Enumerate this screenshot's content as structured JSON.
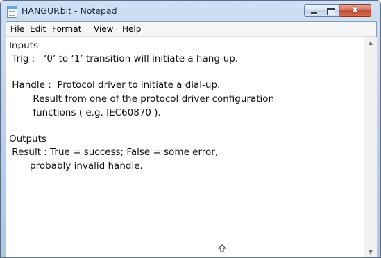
{
  "window": {
    "title": "HANGUP.blt - Notepad",
    "close_glyph": "x"
  },
  "menu": {
    "items": [
      {
        "accel": "F",
        "rest": "ile"
      },
      {
        "accel": "E",
        "rest": "dit"
      },
      {
        "pre": "F",
        "accel": "o",
        "rest": "rmat"
      },
      {
        "accel": "V",
        "rest": "iew"
      },
      {
        "accel": "H",
        "rest": "elp"
      }
    ]
  },
  "document": {
    "lines": [
      "Inputs",
      " Trig :   ‘0’ to ‘1’ transition will initiate a hang-up.",
      "",
      " Handle :  Protocol driver to initiate a dial-up.",
      "        Result from one of the protocol driver configuration",
      "        functions ( e.g. IEC60870 ).",
      "",
      "Outputs",
      " Result : True = success; False = some error,",
      "       probably invalid handle."
    ]
  },
  "scrollbar": {
    "up_arrow": "▲",
    "down_arrow": "▼"
  },
  "icons": {
    "app": "notepad-icon",
    "cursor": "mouse-cursor-icon"
  },
  "colors": {
    "titlebar": "#bcd1ea",
    "close_button": "#c04c33",
    "menubar": "#f5f6f7",
    "text": "#111111"
  }
}
